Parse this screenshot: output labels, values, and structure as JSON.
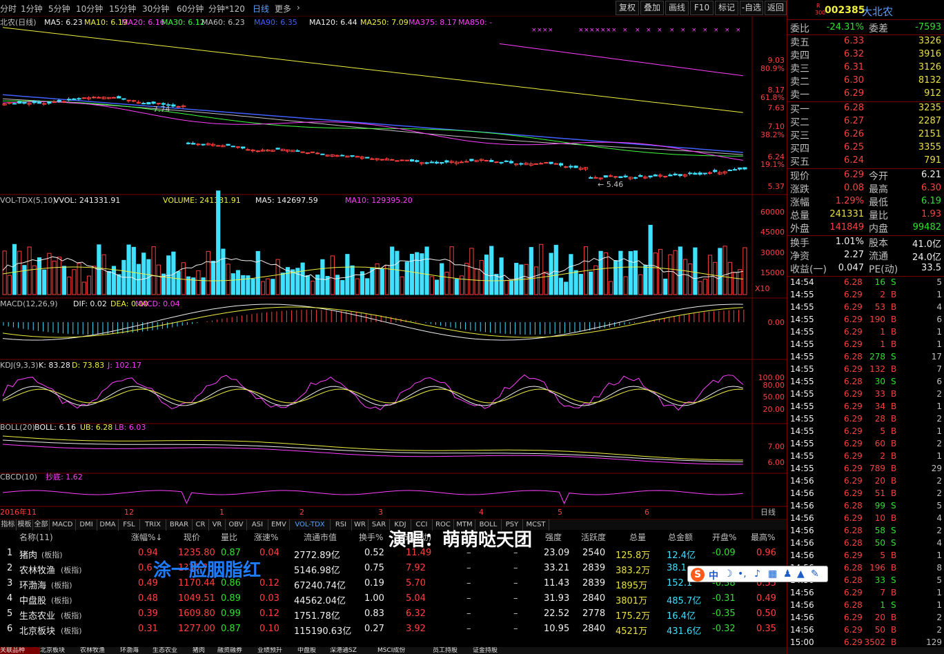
{
  "topbar": {
    "periods": [
      "分时",
      "1分钟",
      "5分钟",
      "10分钟",
      "15分钟",
      "30分钟",
      "60分钟",
      "分钟*120",
      "日线",
      "更多"
    ],
    "selected": "日线",
    "buttons": [
      "复权",
      "叠加",
      "画线",
      "F10",
      "标记",
      "-自选",
      "返回"
    ]
  },
  "main_chart": {
    "title": "北农(日线)",
    "ma": [
      {
        "label": "MA5: 6.23",
        "color": "#f0f0f0"
      },
      {
        "label": "MA10: 6.19",
        "color": "#f0f040"
      },
      {
        "label": "MA20: 6.16",
        "color": "#ff40ff"
      },
      {
        "label": "MA30: 6.12",
        "color": "#40ff40"
      },
      {
        "label": "MA60: 6.23",
        "color": "#c0c0c0"
      },
      {
        "label": "MA90: 6.35",
        "color": "#4060ff"
      },
      {
        "label": "MA120: 6.44",
        "color": "#f0f0f0"
      },
      {
        "label": "MA250: 7.09",
        "color": "#f0f040"
      },
      {
        "label": "MA375: 8.17",
        "color": "#ff40ff"
      },
      {
        "label": "MA850: -",
        "color": "#ff40ff"
      }
    ],
    "axis": [
      "9.03",
      "80.9%",
      "8.17",
      "61.8%",
      "7.63",
      "7.10",
      "38.2%",
      "6.24",
      "19.1%",
      "5.37"
    ],
    "low_marker": "5.46",
    "high_marker": "7.74"
  },
  "vol_panel": {
    "title": "VOL-TDX(5,10)",
    "vol": "VVOL: 241331.91",
    "volume": "VOLUME: 241331.91",
    "ma5": "MA5: 142697.59",
    "ma10": "MA10: 129395.20",
    "axis": [
      "60000",
      "45000",
      "30000",
      "15000"
    ],
    "unit": "X10"
  },
  "macd_panel": {
    "title": "MACD(12,26,9)",
    "dif": "DIF: 0.02",
    "dea": "DEA: 0.00",
    "macd": "MACD: 0.04",
    "axis": [
      "0.00"
    ]
  },
  "kdj_panel": {
    "title": "KDJ(9,3,3)",
    "k": "K: 83.28",
    "d": "D: 73.83",
    "j": "J: 102.17",
    "axis": [
      "100.00",
      "80.00",
      "50.00",
      "20.00"
    ]
  },
  "boll_panel": {
    "title": "BOLL(20)",
    "boll": "BOLL: 6.16",
    "ub": "UB: 6.28",
    "lb": "LB: 6.03",
    "axis": [
      "7.00",
      "6.00"
    ]
  },
  "cbcd_panel": {
    "title": "CBCD(10)",
    "val": "抄底: 1.62"
  },
  "timeaxis": [
    "2016年11",
    "12",
    "1",
    "2",
    "3",
    "4",
    "5",
    "6"
  ],
  "timeaxis_right": "日线",
  "ind_tabs": [
    "指标",
    "模板",
    "全部",
    "MACD",
    "DMI",
    "DMA",
    "FSL",
    "TRIX",
    "BRAR",
    "CR",
    "VR",
    "OBV",
    "ASI",
    "EMV",
    "VOL-TDX",
    "RSI",
    "WR",
    "SAR",
    "KDJ",
    "CCI",
    "ROC",
    "MTM",
    "BOLL",
    "PSY",
    "MCST"
  ],
  "ind_tab_selected": "VOL-TDX",
  "table": {
    "headers": [
      "名称(11)",
      "涨幅%↓",
      "现价",
      "量比",
      "涨速%",
      "流通市值",
      "换手%",
      "市盈(动)",
      "",
      "",
      "强度",
      "活跃度",
      "总量",
      "总金额",
      "开盘%",
      "最高%"
    ],
    "rows": [
      {
        "no": "1",
        "name": "猪肉",
        "tag": "(板指)",
        "chg": "0.94",
        "price": "1235.80",
        "lb": "0.87",
        "spd": "0.04",
        "mv": "2772.89亿",
        "hs": "0.52",
        "pe": "11.49",
        "a": "–",
        "b": "–",
        "str": "23.09",
        "act": "2540",
        "vol": "125.8万",
        "amt": "12.4亿",
        "open": "-0.09",
        "high": "0.96"
      },
      {
        "no": "2",
        "name": "农林牧渔",
        "tag": "(板指)",
        "chg": "0.6",
        "price": "1?35.?",
        "lb": "",
        "spd": "",
        "mv": "5146.98亿",
        "hs": "0.75",
        "pe": "7.92",
        "a": "–",
        "b": "–",
        "str": "33.21",
        "act": "2839",
        "vol": "383.2万",
        "amt": "38.1",
        "open": "",
        "high": ""
      },
      {
        "no": "3",
        "name": "环渤海",
        "tag": "(板指)",
        "chg": "0.49",
        "price": "1170.44",
        "lb": "0.86",
        "spd": "0.12",
        "mv": "67240.74亿",
        "hs": "0.19",
        "pe": "5.70",
        "a": "–",
        "b": "–",
        "str": "11.43",
        "act": "2839",
        "vol": "1895万",
        "amt": "152.1",
        "open": "-0.38",
        "high": "0.55"
      },
      {
        "no": "4",
        "name": "中盘股",
        "tag": "(板指)",
        "chg": "0.48",
        "price": "1049.51",
        "lb": "0.89",
        "spd": "0.03",
        "mv": "44562.04亿",
        "hs": "1.00",
        "pe": "5.04",
        "a": "–",
        "b": "–",
        "str": "31.93",
        "act": "2840",
        "vol": "3801万",
        "amt": "485.7亿",
        "open": "-0.31",
        "high": "0.49"
      },
      {
        "no": "5",
        "name": "生态农业",
        "tag": "(板指)",
        "chg": "0.39",
        "price": "1609.80",
        "lb": "0.99",
        "spd": "0.12",
        "mv": "1751.78亿",
        "hs": "0.83",
        "pe": "6.32",
        "a": "–",
        "b": "–",
        "str": "22.52",
        "act": "2778",
        "vol": "175.2万",
        "amt": "16.4亿",
        "open": "-0.35",
        "high": "0.50"
      },
      {
        "no": "6",
        "name": "北京板块",
        "tag": "(板指)",
        "chg": "0.31",
        "price": "1277.00",
        "lb": "0.87",
        "spd": "0.10",
        "mv": "115190.63亿",
        "hs": "0.27",
        "pe": "3.92",
        "a": "–",
        "b": "–",
        "str": "10.95",
        "act": "2840",
        "vol": "4521万",
        "amt": "431.6亿",
        "open": "-0.32",
        "high": "0.35"
      }
    ]
  },
  "bottom_tabs": [
    "关联品种",
    "北京板块",
    "农林牧渔",
    "环渤海",
    "生态农业",
    "猪肉",
    "融资融券",
    "业绩预升",
    "中盘股",
    "深港通SZ",
    "MSCI成份",
    "员工持股",
    "证金持股"
  ],
  "overlays": {
    "singer": "演唱：萌萌哒天团",
    "lyric": "涂一脸胭脂红",
    "ime": "中"
  },
  "side": {
    "code": "002385",
    "name": "大北农",
    "badge_r": "R",
    "badge_300": "300",
    "weibi_label": "委比",
    "weibi": "-24.31%",
    "weicha_label": "委差",
    "weicha": "-7593",
    "asks": [
      {
        "label": "卖五",
        "price": "6.33",
        "vol": "3326"
      },
      {
        "label": "卖四",
        "price": "6.32",
        "vol": "3916"
      },
      {
        "label": "卖三",
        "price": "6.31",
        "vol": "3126"
      },
      {
        "label": "卖二",
        "price": "6.30",
        "vol": "8132"
      },
      {
        "label": "卖一",
        "price": "6.29",
        "vol": "912"
      }
    ],
    "bids": [
      {
        "label": "买一",
        "price": "6.28",
        "vol": "3235"
      },
      {
        "label": "买二",
        "price": "6.27",
        "vol": "2287"
      },
      {
        "label": "买三",
        "price": "6.26",
        "vol": "2151"
      },
      {
        "label": "买四",
        "price": "6.25",
        "vol": "3355"
      },
      {
        "label": "买五",
        "price": "6.24",
        "vol": "791"
      }
    ],
    "stats": [
      {
        "k1": "现价",
        "v1": "6.29",
        "c1": "red",
        "k2": "今开",
        "v2": "6.21",
        "c2": "wht"
      },
      {
        "k1": "涨跌",
        "v1": "0.08",
        "c1": "red",
        "k2": "最高",
        "v2": "6.30",
        "c2": "red"
      },
      {
        "k1": "涨幅",
        "v1": "1.29%",
        "c1": "red",
        "k2": "最低",
        "v2": "6.19",
        "c2": "grn"
      },
      {
        "k1": "总量",
        "v1": "241331",
        "c1": "yel",
        "k2": "量比",
        "v2": "1.93",
        "c2": "red"
      },
      {
        "k1": "外盘",
        "v1": "141849",
        "c1": "red",
        "k2": "内盘",
        "v2": "99482",
        "c2": "grn"
      }
    ],
    "stats2": [
      {
        "k1": "换手",
        "v1": "1.01%",
        "k2": "股本",
        "v2": "41.0亿"
      },
      {
        "k1": "净资",
        "v1": "2.27",
        "k2": "流通",
        "v2": "24.0亿"
      },
      {
        "k1": "收益(一)",
        "v1": "0.047",
        "k2": "PE(动)",
        "v2": "33.5"
      }
    ],
    "ticks": [
      {
        "t": "14:54",
        "p": "6.28",
        "v": "16",
        "s": "S",
        "n": "5"
      },
      {
        "t": "14:55",
        "p": "6.29",
        "v": "2",
        "s": "B",
        "n": "1"
      },
      {
        "t": "14:55",
        "p": "6.29",
        "v": "53",
        "s": "B",
        "n": "4"
      },
      {
        "t": "14:55",
        "p": "6.29",
        "v": "190",
        "s": "B",
        "n": "6"
      },
      {
        "t": "14:55",
        "p": "6.29",
        "v": "1",
        "s": "B",
        "n": "1"
      },
      {
        "t": "14:55",
        "p": "6.29",
        "v": "1",
        "s": "B",
        "n": "1"
      },
      {
        "t": "14:55",
        "p": "6.28",
        "v": "278",
        "s": "S",
        "n": "17"
      },
      {
        "t": "14:55",
        "p": "6.29",
        "v": "132",
        "s": "B",
        "n": "7"
      },
      {
        "t": "14:55",
        "p": "6.28",
        "v": "30",
        "s": "S",
        "n": "6"
      },
      {
        "t": "14:55",
        "p": "6.29",
        "v": "33",
        "s": "B",
        "n": "2"
      },
      {
        "t": "14:55",
        "p": "6.29",
        "v": "34",
        "s": "B",
        "n": "1"
      },
      {
        "t": "14:55",
        "p": "6.29",
        "v": "28",
        "s": "B",
        "n": "2"
      },
      {
        "t": "14:55",
        "p": "6.29",
        "v": "5",
        "s": "B",
        "n": "1"
      },
      {
        "t": "14:55",
        "p": "6.29",
        "v": "60",
        "s": "B",
        "n": "2"
      },
      {
        "t": "14:55",
        "p": "6.29",
        "v": "2",
        "s": "B",
        "n": "1"
      },
      {
        "t": "14:55",
        "p": "6.29",
        "v": "789",
        "s": "B",
        "n": "29"
      },
      {
        "t": "14:56",
        "p": "6.29",
        "v": "20",
        "s": "B",
        "n": "2"
      },
      {
        "t": "14:56",
        "p": "6.29",
        "v": "51",
        "s": "B",
        "n": "2"
      },
      {
        "t": "14:56",
        "p": "6.28",
        "v": "99",
        "s": "S",
        "n": "5"
      },
      {
        "t": "14:56",
        "p": "6.29",
        "v": "10",
        "s": "B",
        "n": "4"
      },
      {
        "t": "14:56",
        "p": "6.28",
        "v": "58",
        "s": "S",
        "n": "2"
      },
      {
        "t": "14:56",
        "p": "6.28",
        "v": "50",
        "s": "S",
        "n": "4"
      },
      {
        "t": "14:56",
        "p": "6.29",
        "v": "5",
        "s": "B",
        "n": "1"
      },
      {
        "t": "14:56",
        "p": "6.28",
        "v": "196",
        "s": "B",
        "n": "8"
      },
      {
        "t": "14:56",
        "p": "6.28",
        "v": "33",
        "s": "S",
        "n": "5"
      },
      {
        "t": "14:56",
        "p": "6.29",
        "v": "7",
        "s": "B",
        "n": "1"
      },
      {
        "t": "14:56",
        "p": "6.28",
        "v": "1",
        "s": "S",
        "n": "1"
      },
      {
        "t": "14:56",
        "p": "6.29",
        "v": "20",
        "s": "B",
        "n": "2"
      },
      {
        "t": "14:56",
        "p": "6.29",
        "v": "50",
        "s": "B",
        "n": "2"
      },
      {
        "t": "15:00",
        "p": "6.29",
        "v": "3502",
        "s": "B",
        "n": "129"
      }
    ]
  },
  "colors": {
    "up": "#ff4040",
    "down": "#40e0ff",
    "grid": "#7a0000",
    "accent": "#5aa0ff"
  }
}
